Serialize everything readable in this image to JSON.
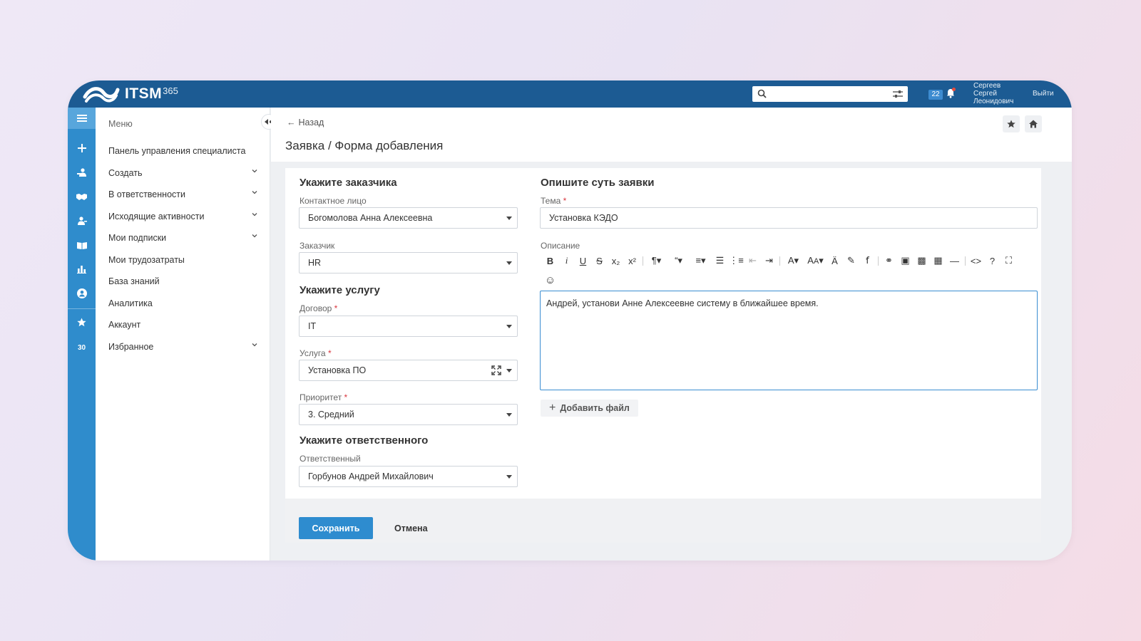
{
  "app": {
    "logo_text": "ITSM",
    "logo_sup": "365"
  },
  "header": {
    "search_placeholder": "",
    "notifications_count": "22",
    "user": [
      "Сергеев",
      "Сергей",
      "Леонидович"
    ],
    "logout_label": "Выйти"
  },
  "rail": {
    "favorites_count": "30"
  },
  "menu": {
    "title": "Меню",
    "items": [
      {
        "label": "Панель управления специалиста",
        "has_children": false
      },
      {
        "label": "Создать",
        "has_children": true
      },
      {
        "label": "В ответственности",
        "has_children": true
      },
      {
        "label": "Исходящие активности",
        "has_children": true
      },
      {
        "label": "Мои подписки",
        "has_children": true
      },
      {
        "label": "Мои трудозатраты",
        "has_children": false
      },
      {
        "label": "База знаний",
        "has_children": false
      },
      {
        "label": "Аналитика",
        "has_children": false
      },
      {
        "label": "Аккаунт",
        "has_children": false
      },
      {
        "label": "Избранное",
        "has_children": true
      }
    ]
  },
  "page": {
    "back_label": "Назад",
    "title": "Заявка / Форма добавления"
  },
  "form": {
    "customer_section": "Укажите заказчика",
    "contact_label": "Контактное лицо",
    "contact_value": "Богомолова Анна Алексеевна",
    "customer_label": "Заказчик",
    "customer_value": "HR",
    "service_section": "Укажите услугу",
    "contract_label": "Договор",
    "contract_value": "IT",
    "service_label": "Услуга",
    "service_value": "Установка ПО",
    "priority_label": "Приоритет",
    "priority_value": "3. Средний",
    "responsible_section": "Укажите ответственного",
    "responsible_label": "Ответственный",
    "responsible_value": "Горбунов Андрей Михайлович",
    "request_section": "Опишите суть заявки",
    "subject_label": "Тема",
    "subject_value": "Установка КЭДО",
    "description_label": "Описание",
    "description_value": "Андрей, установи Анне Алексеевне систему в ближайшее время.",
    "add_file_label": "Добавить файл",
    "required_mark": "*"
  },
  "actions": {
    "save_label": "Сохранить",
    "cancel_label": "Отмена"
  },
  "colors": {
    "header": "#1c5b93",
    "rail": "#2f8ccc",
    "primary_button": "#2e8ccf",
    "editor_focus": "#3a8dd1"
  }
}
